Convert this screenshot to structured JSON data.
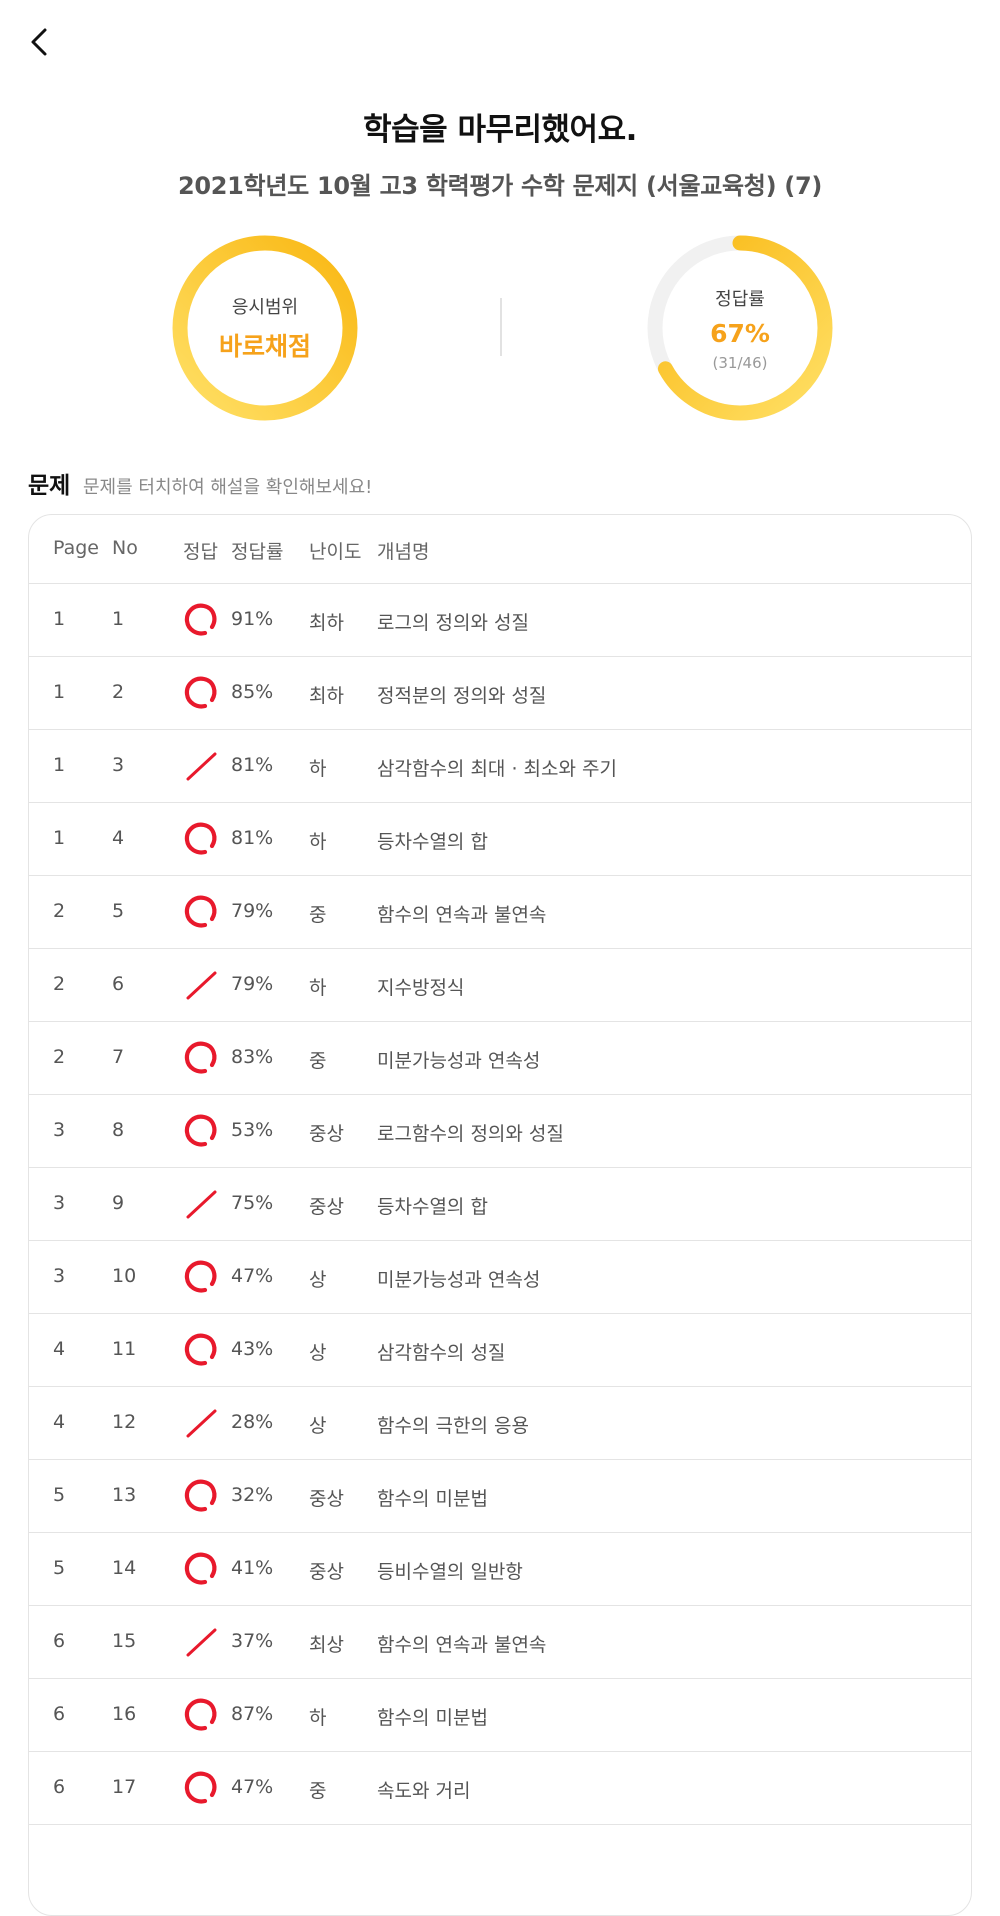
{
  "header": {
    "title": "학습을 마무리했어요.",
    "subtitle": "2021학년도 10월 고3 학력평가 수학 문제지 (서울교육청) (7)"
  },
  "summary": {
    "scope": {
      "label": "응시범위",
      "value": "바로채점"
    },
    "accuracy": {
      "label": "정답률",
      "percent_text": "67%",
      "count_text": "(31/46)",
      "ratio": 0.67
    }
  },
  "colors": {
    "accent": "#f6a21b",
    "correct_mark": "#e8192c",
    "wrong_mark": "#e8192c"
  },
  "section": {
    "title": "문제",
    "hint": "문제를 터치하여 해설을 확인해보세요!"
  },
  "table": {
    "headers": [
      "Page",
      "No",
      "정답",
      "정답률",
      "난이도",
      "개념명"
    ],
    "rows": [
      {
        "page": "1",
        "no": "1",
        "result": "correct",
        "rate": "91%",
        "difficulty": "최하",
        "concept": "로그의 정의와 성질"
      },
      {
        "page": "1",
        "no": "2",
        "result": "correct",
        "rate": "85%",
        "difficulty": "최하",
        "concept": "정적분의 정의와 성질"
      },
      {
        "page": "1",
        "no": "3",
        "result": "wrong",
        "rate": "81%",
        "difficulty": "하",
        "concept": "삼각함수의 최대 · 최소와 주기"
      },
      {
        "page": "1",
        "no": "4",
        "result": "correct",
        "rate": "81%",
        "difficulty": "하",
        "concept": "등차수열의 합"
      },
      {
        "page": "2",
        "no": "5",
        "result": "correct",
        "rate": "79%",
        "difficulty": "중",
        "concept": "함수의 연속과 불연속"
      },
      {
        "page": "2",
        "no": "6",
        "result": "wrong",
        "rate": "79%",
        "difficulty": "하",
        "concept": "지수방정식"
      },
      {
        "page": "2",
        "no": "7",
        "result": "correct",
        "rate": "83%",
        "difficulty": "중",
        "concept": "미분가능성과 연속성"
      },
      {
        "page": "3",
        "no": "8",
        "result": "correct",
        "rate": "53%",
        "difficulty": "중상",
        "concept": "로그함수의 정의와 성질"
      },
      {
        "page": "3",
        "no": "9",
        "result": "wrong",
        "rate": "75%",
        "difficulty": "중상",
        "concept": "등차수열의 합"
      },
      {
        "page": "3",
        "no": "10",
        "result": "correct",
        "rate": "47%",
        "difficulty": "상",
        "concept": "미분가능성과 연속성"
      },
      {
        "page": "4",
        "no": "11",
        "result": "correct",
        "rate": "43%",
        "difficulty": "상",
        "concept": "삼각함수의 성질"
      },
      {
        "page": "4",
        "no": "12",
        "result": "wrong",
        "rate": "28%",
        "difficulty": "상",
        "concept": "함수의 극한의 응용"
      },
      {
        "page": "5",
        "no": "13",
        "result": "correct",
        "rate": "32%",
        "difficulty": "중상",
        "concept": "함수의 미분법"
      },
      {
        "page": "5",
        "no": "14",
        "result": "correct",
        "rate": "41%",
        "difficulty": "중상",
        "concept": "등비수열의 일반항"
      },
      {
        "page": "6",
        "no": "15",
        "result": "wrong",
        "rate": "37%",
        "difficulty": "최상",
        "concept": "함수의 연속과 불연속"
      },
      {
        "page": "6",
        "no": "16",
        "result": "correct",
        "rate": "87%",
        "difficulty": "하",
        "concept": "함수의 미분법"
      },
      {
        "page": "6",
        "no": "17",
        "result": "correct",
        "rate": "47%",
        "difficulty": "중",
        "concept": "속도와 거리"
      }
    ]
  }
}
